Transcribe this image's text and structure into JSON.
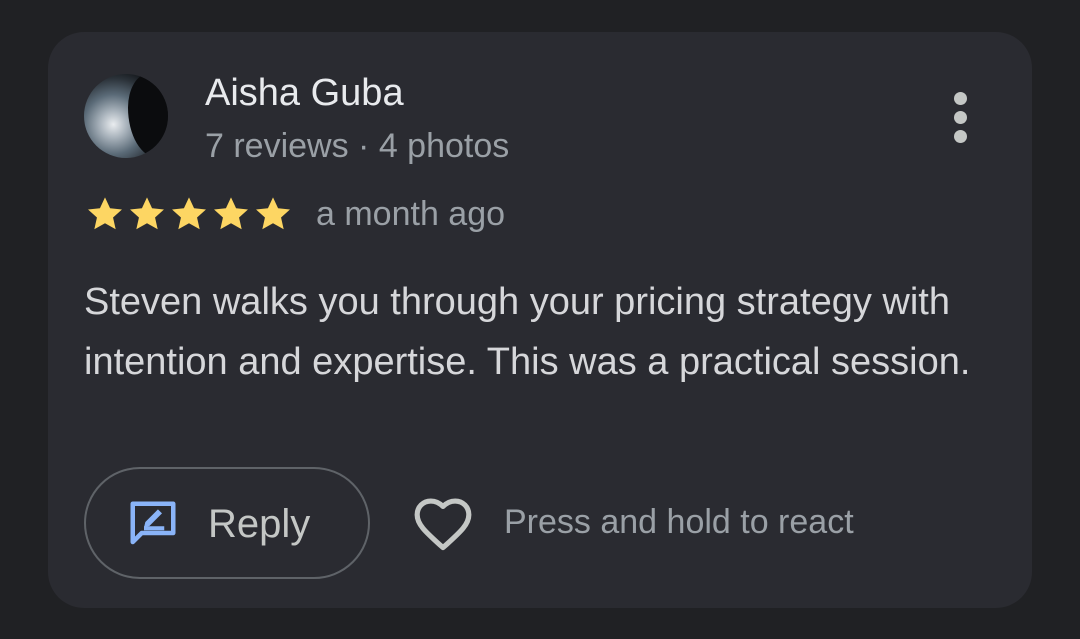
{
  "review": {
    "author": {
      "name": "Aisha Guba",
      "meta": "7 reviews · 4 photos"
    },
    "rating": 5,
    "rating_max": 5,
    "time": "a month ago",
    "text": "Steven walks you through your pricing strategy with intention and expertise. This was a practical session."
  },
  "actions": {
    "reply_label": "Reply",
    "react_hint": "Press and hold to react"
  },
  "icons": {
    "more": "more-vert-icon",
    "star": "star-icon",
    "reply": "reply-edit-icon",
    "heart": "heart-outline-icon"
  },
  "colors": {
    "background": "#202124",
    "card": "#2a2b31",
    "star": "#fdd663",
    "reply_icon": "#8ab4f8",
    "primary_text": "#e8eaed",
    "secondary_text": "#9aa0a6"
  }
}
